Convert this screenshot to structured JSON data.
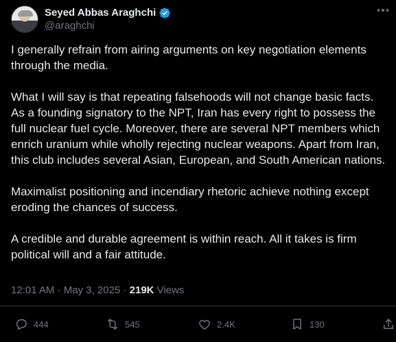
{
  "author": {
    "display_name": "Seyed Abbas Araghchi",
    "handle": "@araghchi"
  },
  "tweet": {
    "paragraphs": [
      "I generally refrain from airing arguments on key negotiation elements\nthrough the media.",
      "What I will say is that repeating falsehoods will not change basic facts.\nAs a founding signatory to the NPT, Iran has every right to possess the\nfull nuclear fuel cycle. Moreover, there are several NPT members which\nenrich uranium while wholly rejecting nuclear weapons. Apart from Iran,\nthis club includes several Asian, European, and South American nations.",
      "Maximalist positioning and incendiary rhetoric achieve nothing except\neroding the chances of success.",
      "A credible and durable agreement is within reach. All it takes is firm\npolitical will and a fair attitude."
    ]
  },
  "meta": {
    "time": "12:01 AM",
    "separator": " · ",
    "date": "May 3, 2025",
    "views_count": "219K",
    "views_label": " Views"
  },
  "actions": {
    "replies": "444",
    "reposts": "545",
    "likes": "2.4K",
    "bookmarks": "130"
  },
  "icons": {
    "verified": "verified-badge-icon",
    "more": "more-icon",
    "reply": "reply-icon",
    "repost": "repost-icon",
    "like": "heart-icon",
    "bookmark": "bookmark-icon",
    "share": "share-icon"
  },
  "colors": {
    "background": "#000000",
    "text": "#e7e9ea",
    "secondary": "#71767b",
    "verified": "#1d9bf0",
    "divider": "#2f3336"
  }
}
